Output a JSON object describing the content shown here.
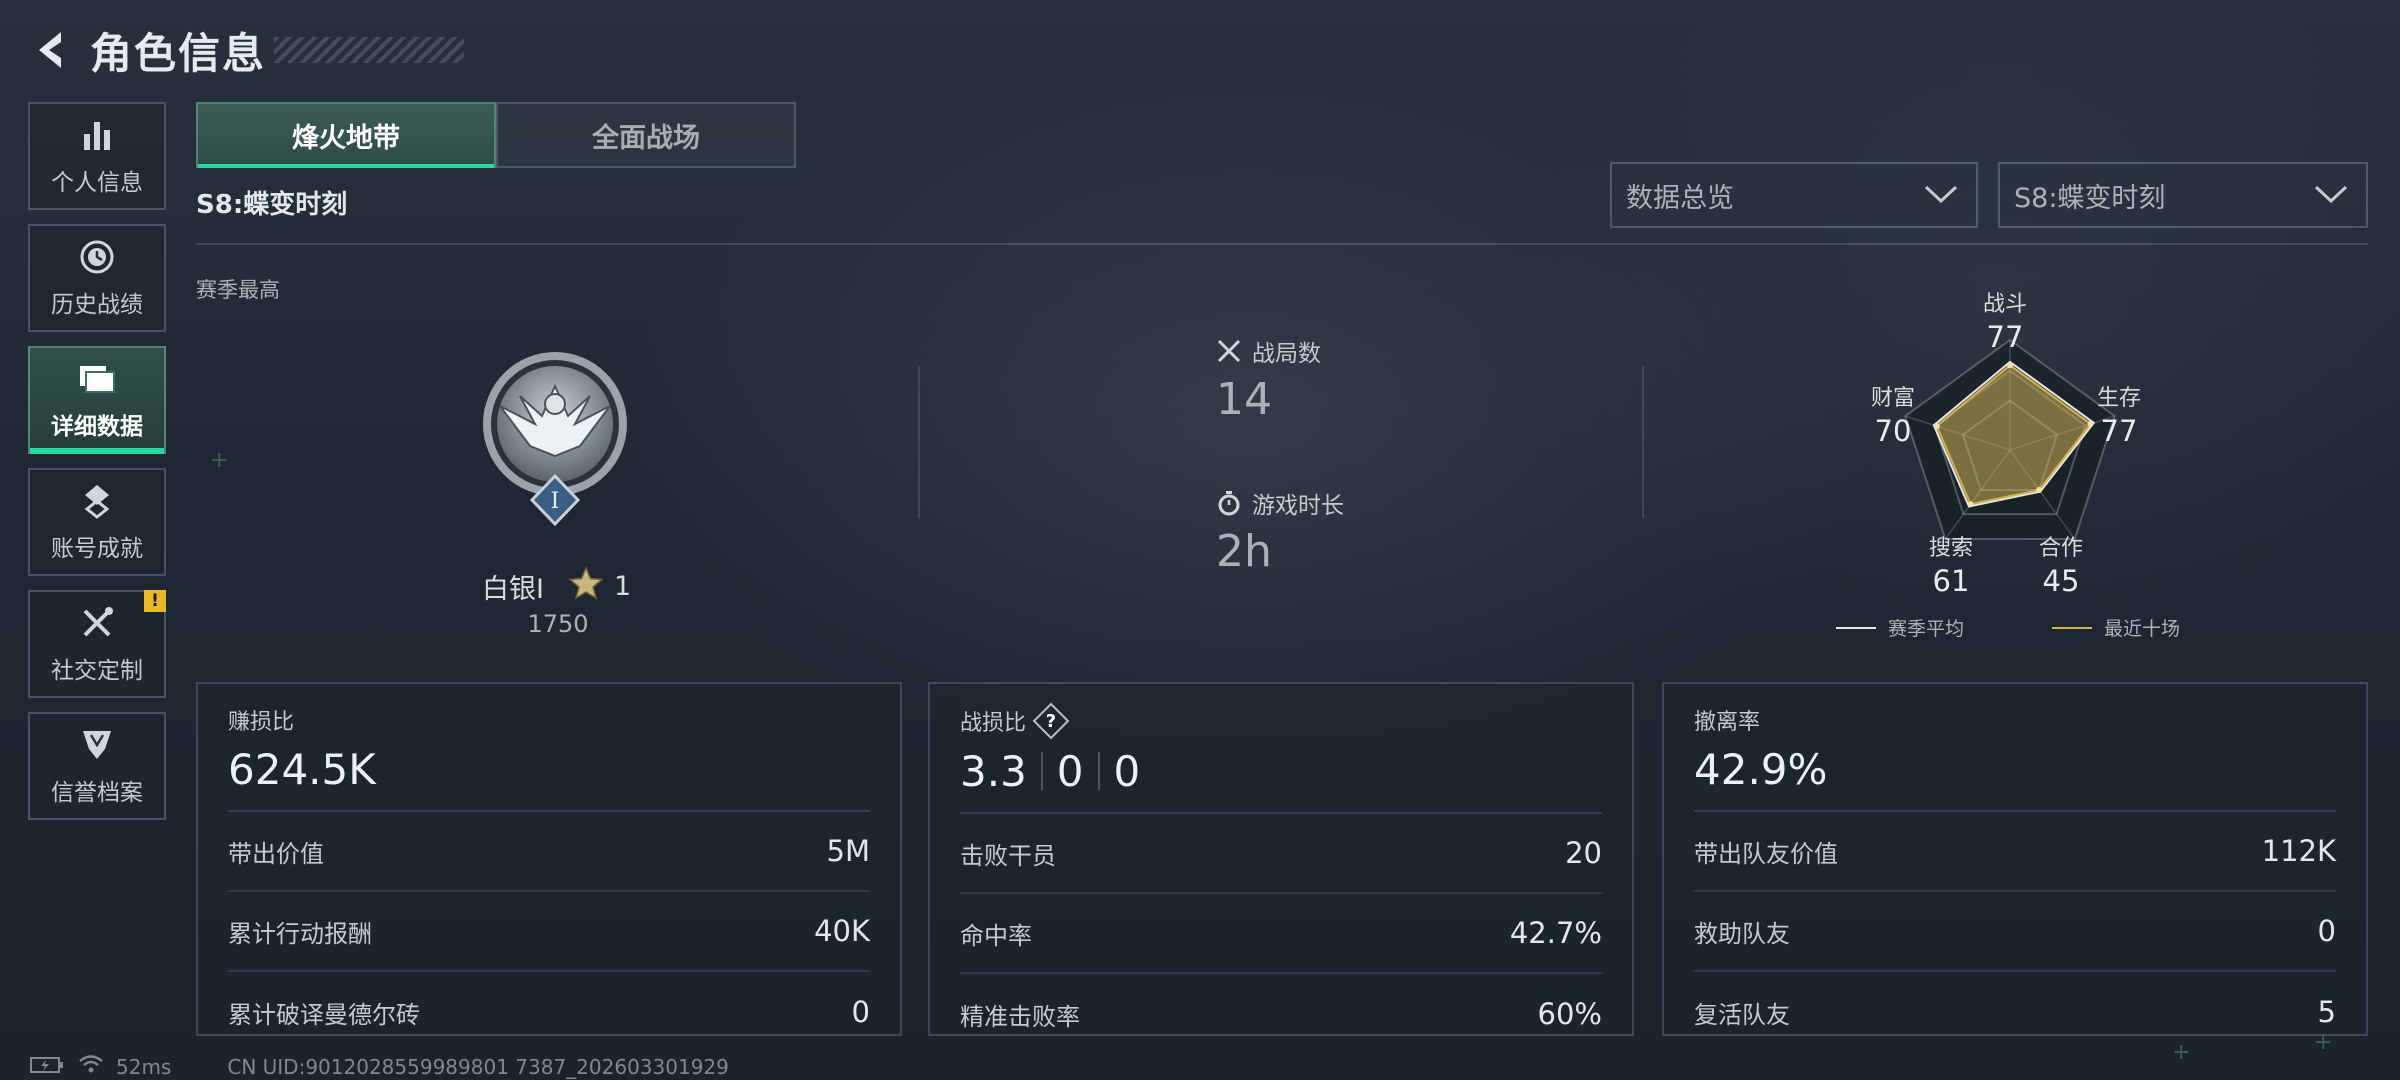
{
  "header": {
    "title": "角色信息"
  },
  "sidebar": {
    "items": [
      {
        "label": "个人信息",
        "icon": "bar-chart-icon"
      },
      {
        "label": "历史战绩",
        "icon": "history-clock-icon"
      },
      {
        "label": "详细数据",
        "icon": "folder-icon",
        "active": true
      },
      {
        "label": "账号成就",
        "icon": "achievement-icon"
      },
      {
        "label": "社交定制",
        "icon": "tools-icon",
        "badge": "!"
      },
      {
        "label": "信誉档案",
        "icon": "shield-icon"
      }
    ]
  },
  "tabs": [
    {
      "label": "烽火地带",
      "active": true
    },
    {
      "label": "全面战场",
      "active": false
    }
  ],
  "season": {
    "label": "S8:蝶变时刻",
    "best_label": "赛季最高"
  },
  "dropdowns": {
    "view": {
      "value": "数据总览"
    },
    "season": {
      "value": "S8:蝶变时刻"
    }
  },
  "rank": {
    "name": "白银I",
    "stars": "1",
    "score": "1750",
    "emblem_numeral": "I"
  },
  "match_stats": {
    "matches": {
      "label": "战局数",
      "value": "14"
    },
    "playtime": {
      "label": "游戏时长",
      "value": "2h"
    }
  },
  "radar": {
    "labels": {
      "combat": {
        "name": "战斗",
        "value": "77"
      },
      "survival": {
        "name": "生存",
        "value": "77"
      },
      "cooperation": {
        "name": "合作",
        "value": "45"
      },
      "search": {
        "name": "搜索",
        "value": "61"
      },
      "wealth": {
        "name": "财富",
        "value": "70"
      }
    },
    "legend": {
      "season_avg": "赛季平均",
      "recent_ten": "最近十场"
    },
    "colors": {
      "season_avg": "#e6e6e6",
      "recent_ten": "#d6b24a"
    }
  },
  "cards": {
    "profit": {
      "title": "赚损比",
      "main": "624.5K",
      "rows": [
        {
          "label": "带出价值",
          "value": "5M"
        },
        {
          "label": "累计行动报酬",
          "value": "40K"
        },
        {
          "label": "累计破译曼德尔砖",
          "value": "0"
        }
      ]
    },
    "kd": {
      "title": "战损比",
      "main_parts": [
        "3.3",
        "0",
        "0"
      ],
      "rows": [
        {
          "label": "击败干员",
          "value": "20"
        },
        {
          "label": "命中率",
          "value": "42.7%"
        },
        {
          "label": "精准击败率",
          "value": "60%"
        }
      ]
    },
    "extract": {
      "title": "撤离率",
      "main": "42.9%",
      "rows": [
        {
          "label": "带出队友价值",
          "value": "112K"
        },
        {
          "label": "救助队友",
          "value": "0"
        },
        {
          "label": "复活队友",
          "value": "5"
        }
      ]
    }
  },
  "footer": {
    "ping": "52ms",
    "uid": "CN UID:9012028559989801 7387_202603301929"
  }
}
